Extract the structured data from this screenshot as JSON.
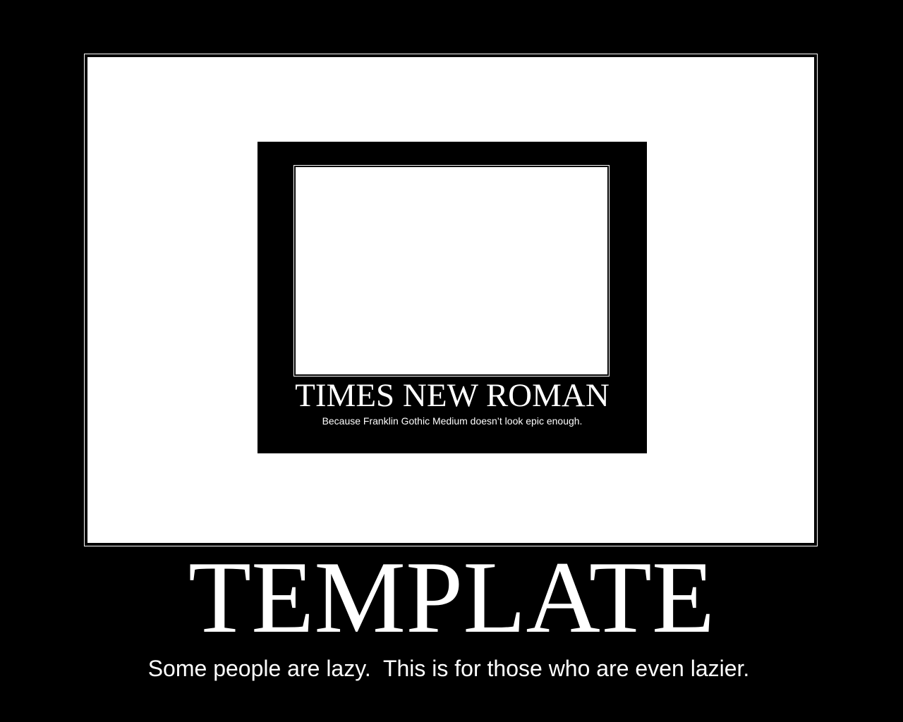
{
  "poster": {
    "title": "TEMPLATE",
    "caption": "Some people are lazy.  This is for those who are even lazier.",
    "inner_poster": {
      "title": "TIMES NEW ROMAN",
      "caption": "Because Franklin Gothic Medium doesn’t look epic enough."
    }
  },
  "colors": {
    "background": "#000000",
    "frame": "#ffffff",
    "text": "#ffffff"
  }
}
